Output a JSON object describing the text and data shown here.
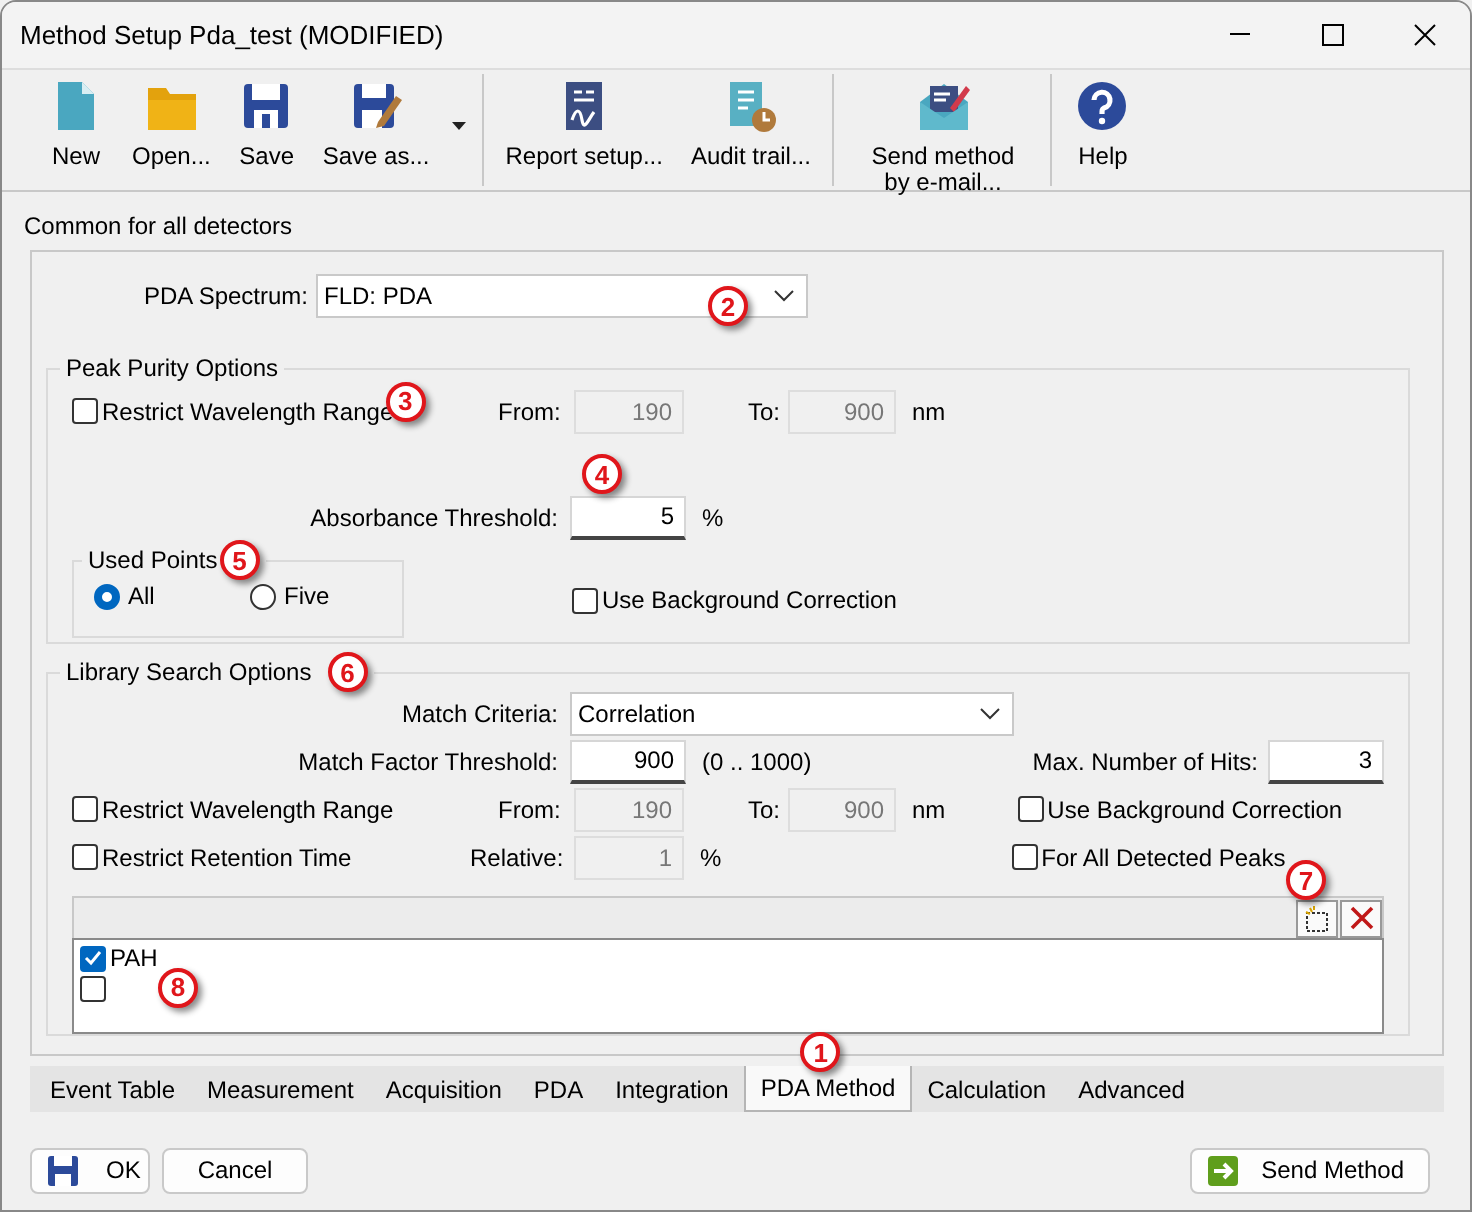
{
  "window": {
    "title": "Method Setup Pda_test (MODIFIED)"
  },
  "toolbar": {
    "groups": [
      [
        {
          "kind": "new",
          "label": "New"
        },
        {
          "kind": "open",
          "label": "Open..."
        },
        {
          "kind": "save",
          "label": "Save"
        },
        {
          "kind": "save_as",
          "label": "Save as...",
          "menu": true
        }
      ],
      [
        {
          "kind": "report",
          "label": "Report setup..."
        },
        {
          "kind": "audit",
          "label": "Audit trail..."
        }
      ],
      [
        {
          "kind": "email",
          "label": "Send method by e-mail..."
        }
      ],
      [
        {
          "kind": "help",
          "label": "Help"
        }
      ]
    ]
  },
  "section_title": "Common for all detectors",
  "pda_spectrum": {
    "label": "PDA Spectrum:",
    "value": "FLD: PDA",
    "callout": "2"
  },
  "peak_purity": {
    "title": "Peak Purity Options",
    "restrict_wavelength": {
      "label": "Restrict Wavelength Range",
      "checked": false,
      "callout": "3"
    },
    "from": {
      "label": "From:",
      "value": "190",
      "disabled": true
    },
    "to": {
      "label": "To:",
      "value": "900",
      "disabled": true
    },
    "unit": "nm",
    "absorbance_threshold": {
      "label": "Absorbance Threshold:",
      "value": "5",
      "unit": "%",
      "callout": "4"
    },
    "used_points": {
      "title": "Used Points",
      "callout": "5",
      "options": [
        {
          "label": "All",
          "selected": true
        },
        {
          "label": "Five",
          "selected": false
        }
      ]
    },
    "background_correction": {
      "label": "Use Background Correction",
      "checked": false
    }
  },
  "library_search": {
    "title": "Library Search Options",
    "callout": "6",
    "match_criteria": {
      "label": "Match Criteria:",
      "value": "Correlation"
    },
    "match_factor_threshold": {
      "label": "Match Factor Threshold:",
      "value": "900",
      "range": "(0 .. 1000)"
    },
    "max_hits": {
      "label": "Max. Number of Hits:",
      "value": "3"
    },
    "restrict_wavelength": {
      "label": "Restrict Wavelength Range",
      "checked": false
    },
    "from": {
      "label": "From:",
      "value": "190",
      "disabled": true
    },
    "to": {
      "label": "To:",
      "value": "900",
      "disabled": true
    },
    "unit": "nm",
    "background_correction": {
      "label": "Use Background Correction",
      "checked": false
    },
    "restrict_retention": {
      "label": "Restrict Retention Time",
      "checked": false
    },
    "relative": {
      "label": "Relative:",
      "value": "1",
      "unit": "%",
      "disabled": true
    },
    "all_detected_peaks": {
      "label": "For All Detected Peaks",
      "checked": false
    },
    "libraries": {
      "tools_callout": "7",
      "list_callout": "8",
      "items": [
        {
          "label": "PAH",
          "checked": true
        },
        {
          "checked": false
        }
      ]
    }
  },
  "tabs": [
    {
      "label": "Event Table",
      "selected": false
    },
    {
      "label": "Measurement",
      "selected": false
    },
    {
      "label": "Acquisition",
      "selected": false
    },
    {
      "label": "PDA",
      "selected": false
    },
    {
      "label": "Integration",
      "selected": false
    },
    {
      "label": "PDA Method",
      "selected": true,
      "callout": "1"
    },
    {
      "label": "Calculation",
      "selected": false
    },
    {
      "label": "Advanced",
      "selected": false
    }
  ],
  "buttons": [
    {
      "kind": "ok",
      "label": "OK"
    },
    {
      "kind": "cancel",
      "label": "Cancel"
    },
    {
      "kind": "send",
      "label": "Send Method"
    }
  ]
}
